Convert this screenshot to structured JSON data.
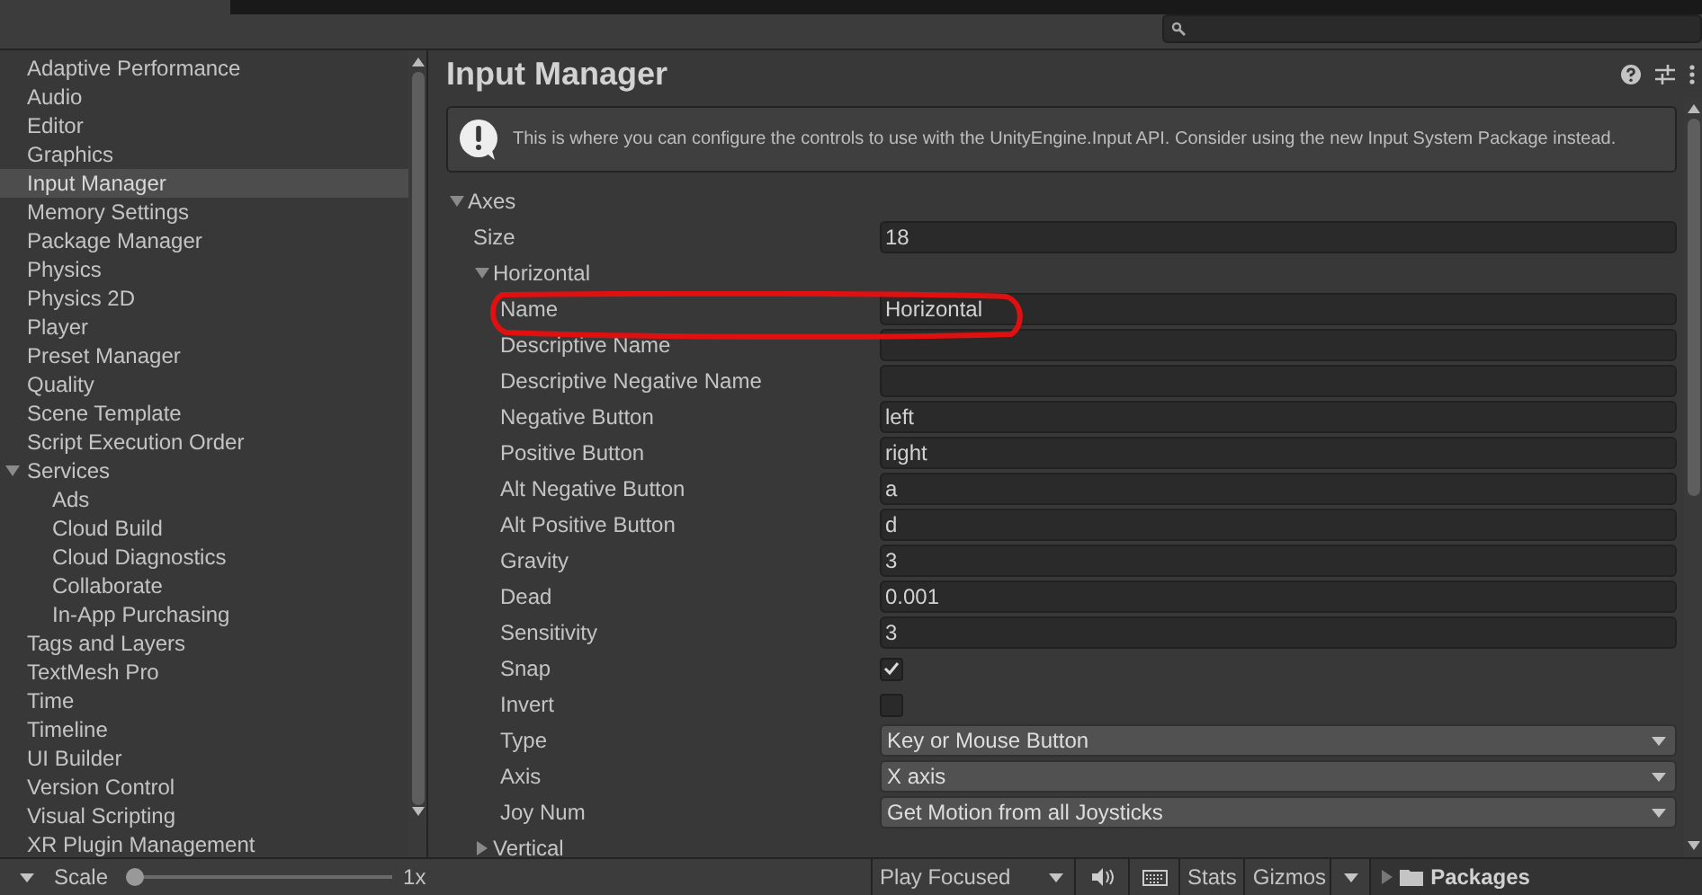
{
  "sidebar": {
    "items": [
      {
        "label": "Adaptive Performance",
        "selected": false
      },
      {
        "label": "Audio",
        "selected": false
      },
      {
        "label": "Editor",
        "selected": false
      },
      {
        "label": "Graphics",
        "selected": false
      },
      {
        "label": "Input Manager",
        "selected": true
      },
      {
        "label": "Memory Settings",
        "selected": false
      },
      {
        "label": "Package Manager",
        "selected": false
      },
      {
        "label": "Physics",
        "selected": false
      },
      {
        "label": "Physics 2D",
        "selected": false
      },
      {
        "label": "Player",
        "selected": false
      },
      {
        "label": "Preset Manager",
        "selected": false
      },
      {
        "label": "Quality",
        "selected": false
      },
      {
        "label": "Scene Template",
        "selected": false
      },
      {
        "label": "Script Execution Order",
        "selected": false
      },
      {
        "label": "Services",
        "selected": false,
        "expanded": true,
        "children": [
          {
            "label": "Ads",
            "selected": false
          },
          {
            "label": "Cloud Build",
            "selected": false
          },
          {
            "label": "Cloud Diagnostics",
            "selected": false
          },
          {
            "label": "Collaborate",
            "selected": false
          },
          {
            "label": "In-App Purchasing",
            "selected": false
          }
        ]
      },
      {
        "label": "Tags and Layers",
        "selected": false
      },
      {
        "label": "TextMesh Pro",
        "selected": false
      },
      {
        "label": "Time",
        "selected": false
      },
      {
        "label": "Timeline",
        "selected": false
      },
      {
        "label": "UI Builder",
        "selected": false
      },
      {
        "label": "Version Control",
        "selected": false
      },
      {
        "label": "Visual Scripting",
        "selected": false
      },
      {
        "label": "XR Plugin Management",
        "selected": false
      }
    ]
  },
  "panel": {
    "title": "Input Manager",
    "info": "This is where you can configure the controls to use with the UnityEngine.Input API. Consider using the new Input System Package instead.",
    "axes": {
      "label": "Axes",
      "expanded": true,
      "size_label": "Size",
      "size": "18",
      "entries": [
        {
          "label": "Horizontal",
          "expanded": true,
          "fields": [
            {
              "kind": "text",
              "label": "Name",
              "value": "Horizontal"
            },
            {
              "kind": "text",
              "label": "Descriptive Name"
            },
            {
              "kind": "text",
              "label": "Descriptive Negative Name"
            },
            {
              "kind": "text",
              "label": "Negative Button",
              "value": "left"
            },
            {
              "kind": "text",
              "label": "Positive Button",
              "value": "right"
            },
            {
              "kind": "text",
              "label": "Alt Negative Button",
              "value": "a"
            },
            {
              "kind": "text",
              "label": "Alt Positive Button",
              "value": "d"
            },
            {
              "kind": "text",
              "label": "Gravity",
              "value": "3"
            },
            {
              "kind": "text",
              "label": "Dead",
              "value": "0.001"
            },
            {
              "kind": "text",
              "label": "Sensitivity",
              "value": "3"
            },
            {
              "kind": "checkbox",
              "label": "Snap",
              "checked": true
            },
            {
              "kind": "checkbox",
              "label": "Invert",
              "checked": false
            },
            {
              "kind": "dropdown",
              "label": "Type",
              "value": "Key or Mouse Button"
            },
            {
              "kind": "dropdown",
              "label": "Axis",
              "value": "X axis"
            },
            {
              "kind": "dropdown",
              "label": "Joy Num",
              "value": "Get Motion from all Joysticks"
            }
          ]
        },
        {
          "label": "Vertical",
          "expanded": false
        }
      ]
    }
  },
  "status_bar": {
    "scale_label": "Scale",
    "scale": {
      "level": 0.0
    },
    "scale_value": "1x",
    "play_mode": "Play Focused",
    "stats": "Stats",
    "gizmos": "Gizmos",
    "folder": "Packages"
  }
}
